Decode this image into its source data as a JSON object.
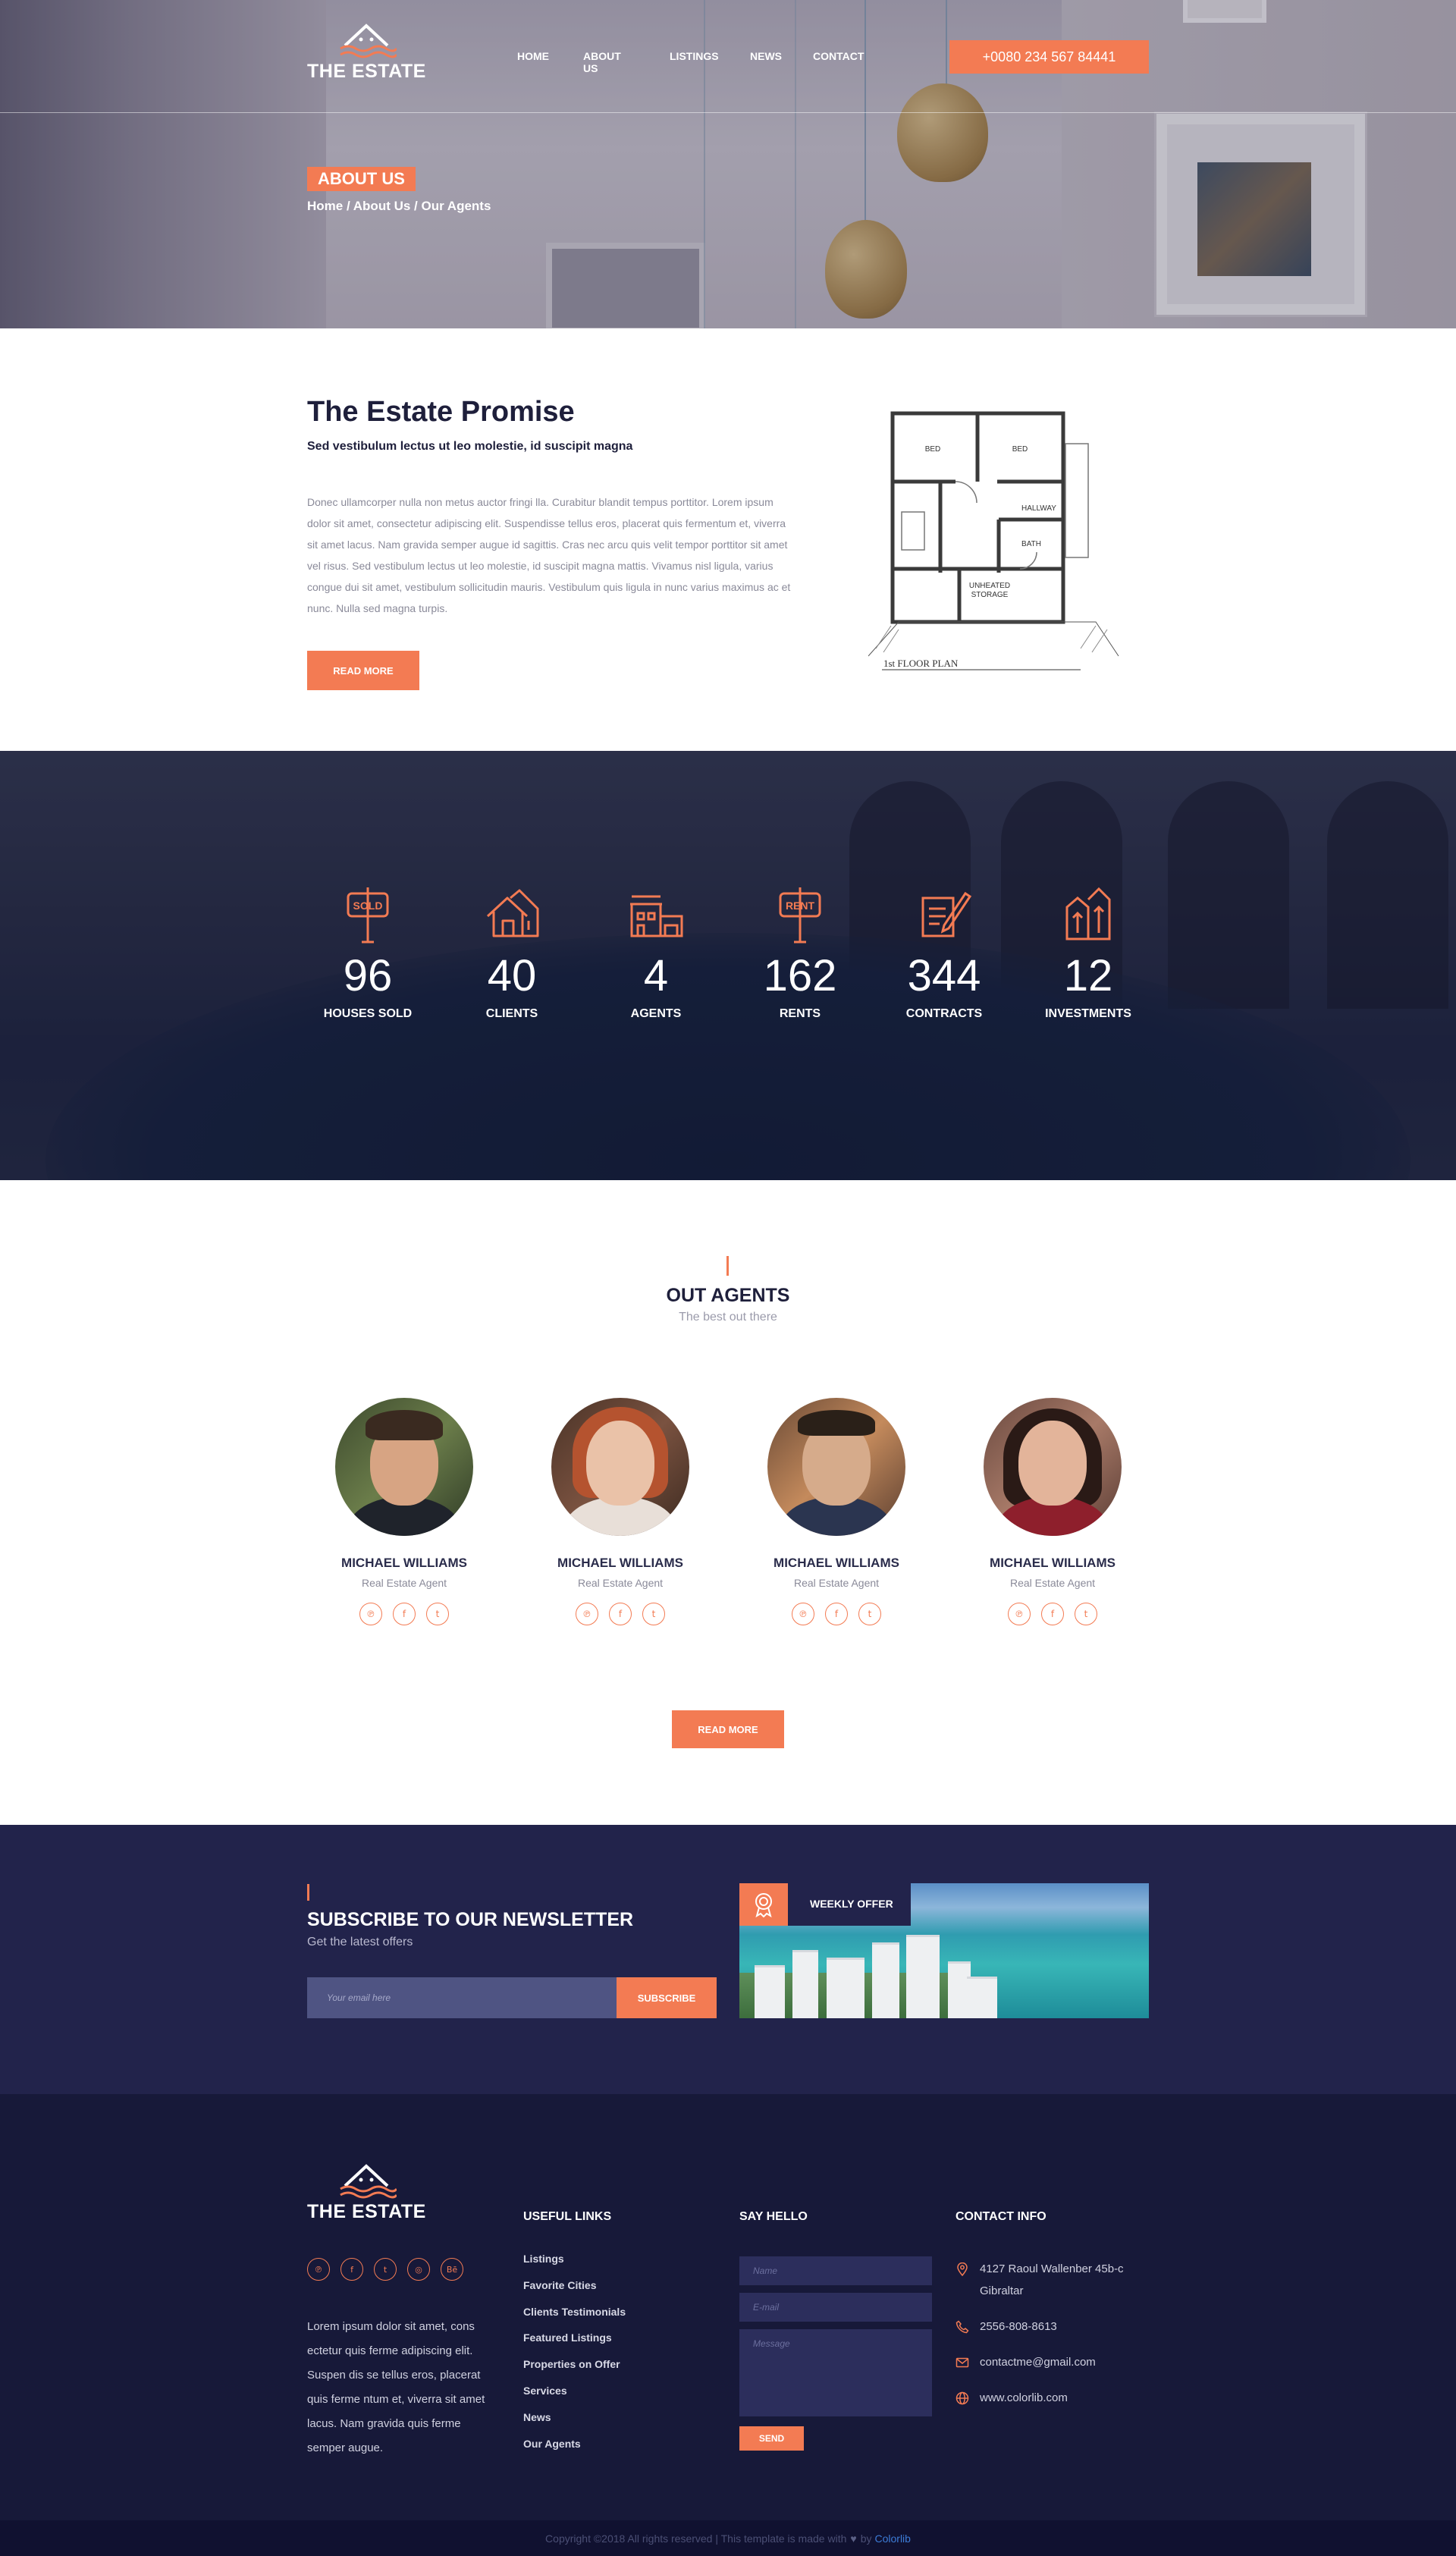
{
  "brand": {
    "name": "THE ESTATE",
    "accent": "#f37b53",
    "navy": "#22234b",
    "footer_bg": "#171939"
  },
  "nav": {
    "items": [
      "HOME",
      "ABOUT US",
      "LISTINGS",
      "NEWS",
      "CONTACT"
    ],
    "phone": "+0080 234 567 84441"
  },
  "hero": {
    "badge": "ABOUT US",
    "breadcrumb": "Home / About Us / Our Agents"
  },
  "promise": {
    "title": "The Estate Promise",
    "subtitle": "Sed vestibulum lectus ut leo molestie, id suscipit magna",
    "body": "Donec ullamcorper nulla non metus auctor fringi lla. Curabitur blandit tempus porttitor. Lorem ipsum dolor sit amet, consectetur adipiscing elit. Suspendisse tellus eros, placerat quis fermentum et, viverra sit amet lacus. Nam gravida semper augue id sagittis. Cras nec arcu quis velit tempor porttitor sit amet vel risus. Sed vestibulum lectus ut leo molestie, id suscipit magna mattis. Vivamus nisl ligula, varius congue dui sit amet, vestibulum sollicitudin mauris. Vestibulum quis ligula in nunc varius maximus ac et nunc. Nulla sed magna turpis.",
    "button": "READ MORE",
    "floorplan": {
      "rooms": [
        "BED",
        "BED",
        "HALLWAY",
        "BATH",
        "UNHEATED",
        "STORAGE"
      ],
      "caption": "1st FLOOR PLAN"
    }
  },
  "stats": [
    {
      "icon": "sold-sign-icon",
      "value": "96",
      "label": "HOUSES SOLD",
      "sign": "SOLD"
    },
    {
      "icon": "house-icon",
      "value": "40",
      "label": "CLIENTS"
    },
    {
      "icon": "building-icon",
      "value": "4",
      "label": "AGENTS"
    },
    {
      "icon": "rent-sign-icon",
      "value": "162",
      "label": "RENTS",
      "sign": "RENT"
    },
    {
      "icon": "contract-icon",
      "value": "344",
      "label": "CONTRACTS"
    },
    {
      "icon": "investment-icon",
      "value": "12",
      "label": "INVESTMENTS"
    }
  ],
  "agents": {
    "title": "OUT AGENTS",
    "subtitle": "The best out there",
    "items": [
      {
        "name": "MICHAEL WILLIAMS",
        "role": "Real Estate Agent"
      },
      {
        "name": "MICHAEL WILLIAMS",
        "role": "Real Estate Agent"
      },
      {
        "name": "MICHAEL WILLIAMS",
        "role": "Real Estate Agent"
      },
      {
        "name": "MICHAEL WILLIAMS",
        "role": "Real Estate Agent"
      }
    ],
    "social_icons": [
      "pinterest-icon",
      "facebook-icon",
      "twitter-icon"
    ],
    "button": "READ MORE"
  },
  "newsletter": {
    "title": "SUBSCRIBE TO OUR NEWSLETTER",
    "subtitle": "Get the latest offers",
    "placeholder": "Your email here",
    "button": "SUBSCRIBE",
    "offer_label": "WEEKLY OFFER"
  },
  "footer": {
    "social_icons": [
      "pinterest-icon",
      "facebook-icon",
      "twitter-icon",
      "dribbble-icon",
      "behance-icon"
    ],
    "about": "Lorem ipsum dolor sit amet, cons ectetur quis ferme adipiscing elit. Suspen dis se tellus eros, placerat quis ferme ntum et, viverra sit amet lacus. Nam gravida quis ferme semper augue.",
    "links_title": "USEFUL LINKS",
    "links": [
      "Listings",
      "Favorite Cities",
      "Clients Testimonials",
      "Featured Listings",
      "Properties on Offer",
      "Services",
      "News",
      "Our Agents"
    ],
    "hello_title": "SAY HELLO",
    "form": {
      "name": "Name",
      "email": "E-mail",
      "message": "Message",
      "send": "SEND"
    },
    "contact_title": "CONTACT INFO",
    "contact": {
      "address": "4127 Raoul Wallenber 45b-c Gibraltar",
      "phone": "2556-808-8613",
      "email": "contactme@gmail.com",
      "website": "www.colorlib.com"
    },
    "copyright": "Copyright ©2018 All rights reserved | This template is made with",
    "copyright_by": "by",
    "copyright_link": "Colorlib"
  }
}
